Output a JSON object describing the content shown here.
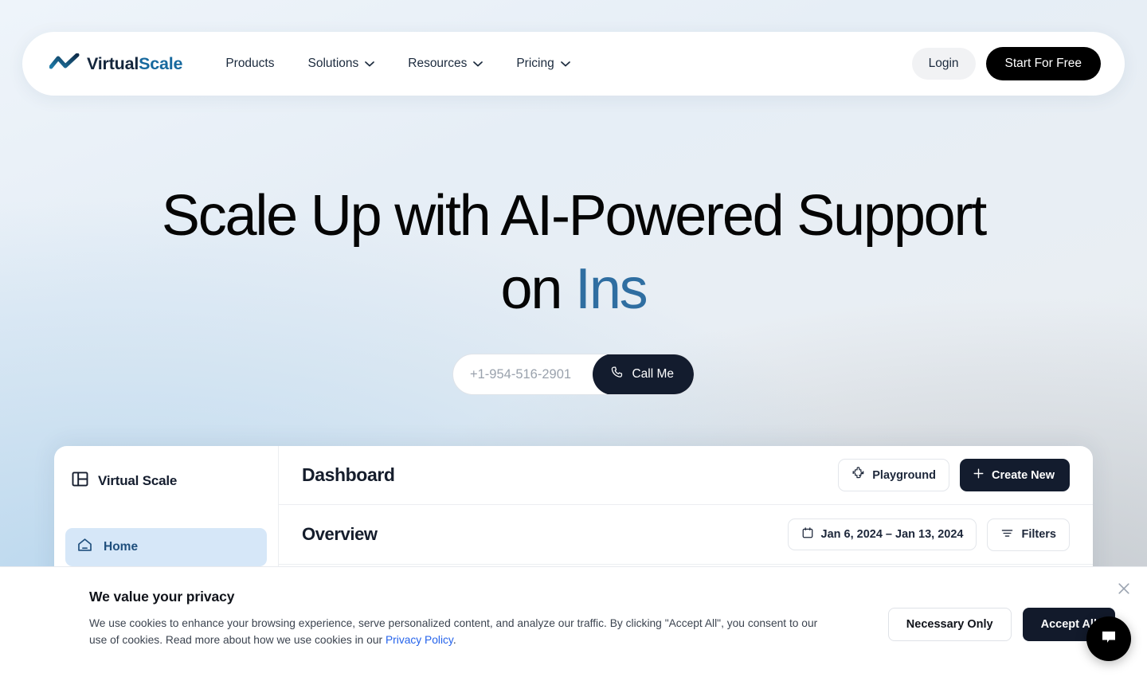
{
  "header": {
    "brand": {
      "icon": "zigzag-logo-icon",
      "name_primary": "Virtual",
      "name_secondary": "Scale"
    },
    "nav": [
      {
        "label": "Products",
        "has_dropdown": false
      },
      {
        "label": "Solutions",
        "has_dropdown": true
      },
      {
        "label": "Resources",
        "has_dropdown": true
      },
      {
        "label": "Pricing",
        "has_dropdown": true
      }
    ],
    "login_label": "Login",
    "start_label": "Start For Free"
  },
  "hero": {
    "line1": "Scale Up with AI-Powered Support",
    "line2_prefix": "on ",
    "line2_accent": "Ins",
    "accent_color": "#2f6ea1",
    "phone_placeholder": "+1-954-516-2901",
    "phone_value": "",
    "call_label": "Call Me",
    "call_icon": "phone-icon"
  },
  "dashboard": {
    "sidebar": {
      "brand_icon": "panel-layout-icon",
      "brand_label": "Virtual Scale",
      "items": [
        {
          "label": "Home",
          "icon": "home-icon",
          "active": true
        }
      ]
    },
    "title": "Dashboard",
    "playground_label": "Playground",
    "playground_icon": "puzzle-icon",
    "create_label": "Create New",
    "create_icon": "plus-icon",
    "overview_label": "Overview",
    "date_range": "Jan 6, 2024 – Jan 13, 2024",
    "date_icon": "calendar-icon",
    "filters_label": "Filters",
    "filters_icon": "filter-icon"
  },
  "cookie": {
    "title": "We value your privacy",
    "body_before": "We use cookies to enhance your browsing experience, serve personalized content, and analyze our traffic. By clicking \"Accept All\", you consent to our use of cookies. Read more about how we use cookies in our ",
    "link_label": "Privacy Policy",
    "body_after": ".",
    "necessary_label": "Necessary Only",
    "accept_label": "Accept All",
    "close_icon": "close-icon"
  },
  "chat": {
    "icon": "chat-bubble-icon"
  }
}
